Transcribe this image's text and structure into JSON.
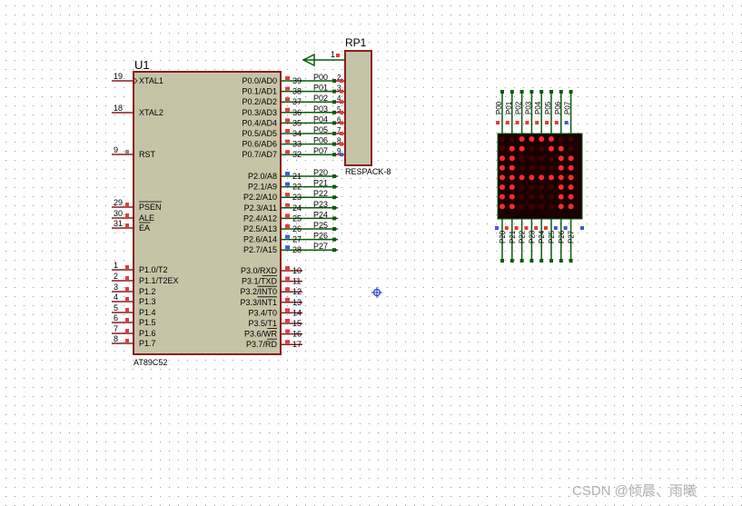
{
  "colors": {
    "background": "#ffffff",
    "grid_dot": "#3c3c3c",
    "chip_fill": "#c6c4a6",
    "chip_border": "#8b1c1c",
    "pin_line": "#8b1c1c",
    "wire": "#0b5a0b",
    "label": "#000000",
    "pin_red": "#e03c3c",
    "pin_blue": "#3a5bd9",
    "led_off": "#400000",
    "led_on": "#ff2a2a",
    "matrix_bg": "#1a0000",
    "watermark": "#b0b0b0"
  },
  "chip": {
    "designator": "U1",
    "part": "AT89C52",
    "left_pins": [
      {
        "num": "19",
        "name": "XTAL1"
      },
      {
        "num": "18",
        "name": "XTAL2"
      },
      {
        "num": "9",
        "name": "RST"
      },
      {
        "num": "29",
        "name": "PSEN",
        "overline": true
      },
      {
        "num": "30",
        "name": "ALE"
      },
      {
        "num": "31",
        "name": "EA",
        "overline": true
      },
      {
        "num": "1",
        "name": "P1.0/T2"
      },
      {
        "num": "2",
        "name": "P1.1/T2EX"
      },
      {
        "num": "3",
        "name": "P1.2"
      },
      {
        "num": "4",
        "name": "P1.3"
      },
      {
        "num": "5",
        "name": "P1.4"
      },
      {
        "num": "6",
        "name": "P1.5"
      },
      {
        "num": "7",
        "name": "P1.6"
      },
      {
        "num": "8",
        "name": "P1.7"
      }
    ],
    "right_pins": [
      {
        "num": "39",
        "name": "P0.0/AD0",
        "net": "P00"
      },
      {
        "num": "38",
        "name": "P0.1/AD1",
        "net": "P01"
      },
      {
        "num": "37",
        "name": "P0.2/AD2",
        "net": "P02"
      },
      {
        "num": "36",
        "name": "P0.3/AD3",
        "net": "P03"
      },
      {
        "num": "35",
        "name": "P0.4/AD4",
        "net": "P04"
      },
      {
        "num": "34",
        "name": "P0.5/AD5",
        "net": "P05"
      },
      {
        "num": "33",
        "name": "P0.6/AD6",
        "net": "P06"
      },
      {
        "num": "32",
        "name": "P0.7/AD7",
        "net": "P07"
      },
      {
        "num": "21",
        "name": "P2.0/A8",
        "net": "P20"
      },
      {
        "num": "22",
        "name": "P2.1/A9",
        "net": "P21"
      },
      {
        "num": "23",
        "name": "P2.2/A10",
        "net": "P22"
      },
      {
        "num": "24",
        "name": "P2.3/A11",
        "net": "P23"
      },
      {
        "num": "25",
        "name": "P2.4/A12",
        "net": "P24"
      },
      {
        "num": "26",
        "name": "P2.5/A13",
        "net": "P25"
      },
      {
        "num": "27",
        "name": "P2.6/A14",
        "net": "P26"
      },
      {
        "num": "28",
        "name": "P2.7/A15",
        "net": "P27"
      },
      {
        "num": "10",
        "name": "P3.0/RXD"
      },
      {
        "num": "11",
        "name": "P3.1/TXD",
        "overline_part": "TXD"
      },
      {
        "num": "12",
        "name": "P3.2/INT0",
        "overline_part": "INT0"
      },
      {
        "num": "13",
        "name": "P3.3/INT1",
        "overline_part": "INT1"
      },
      {
        "num": "14",
        "name": "P3.4/T0"
      },
      {
        "num": "15",
        "name": "P3.5/T1"
      },
      {
        "num": "16",
        "name": "P3.6/WR",
        "overline_part": "WR"
      },
      {
        "num": "17",
        "name": "P3.7/RD",
        "overline_part": "RD"
      }
    ],
    "right_pin_states": [
      "r",
      "r",
      "r",
      "r",
      "r",
      "r",
      "r",
      "r",
      "b",
      "b",
      "r",
      "r",
      "r",
      "r",
      "b",
      "b",
      "r",
      "r",
      "r",
      "r",
      "r",
      "r",
      "r",
      "r"
    ]
  },
  "respack": {
    "designator": "RP1",
    "part": "RESPACK-8",
    "common_pin": "1",
    "pin_numbers": [
      "2",
      "3",
      "4",
      "5",
      "6",
      "7",
      "8",
      "9"
    ]
  },
  "matrix": {
    "top_labels": [
      "P00",
      "P01",
      "P02",
      "P03",
      "P04",
      "P05",
      "P06",
      "P07"
    ],
    "bottom_labels": [
      "P20",
      "P21",
      "P22",
      "P23",
      "P24",
      "P25",
      "P26",
      "P27"
    ],
    "top_pin_states": [
      "r",
      "r",
      "r",
      "r",
      "r",
      "r",
      "r",
      "b"
    ],
    "bottom_pin_states": [
      "b",
      "r",
      "r",
      "r",
      "r",
      "r",
      "b",
      "b"
    ],
    "pattern": [
      "00111100",
      "01100110",
      "11000011",
      "11000011",
      "11111111",
      "11000011",
      "11000011",
      "11000011"
    ]
  },
  "watermark": "CSDN @倾晨、雨曦"
}
